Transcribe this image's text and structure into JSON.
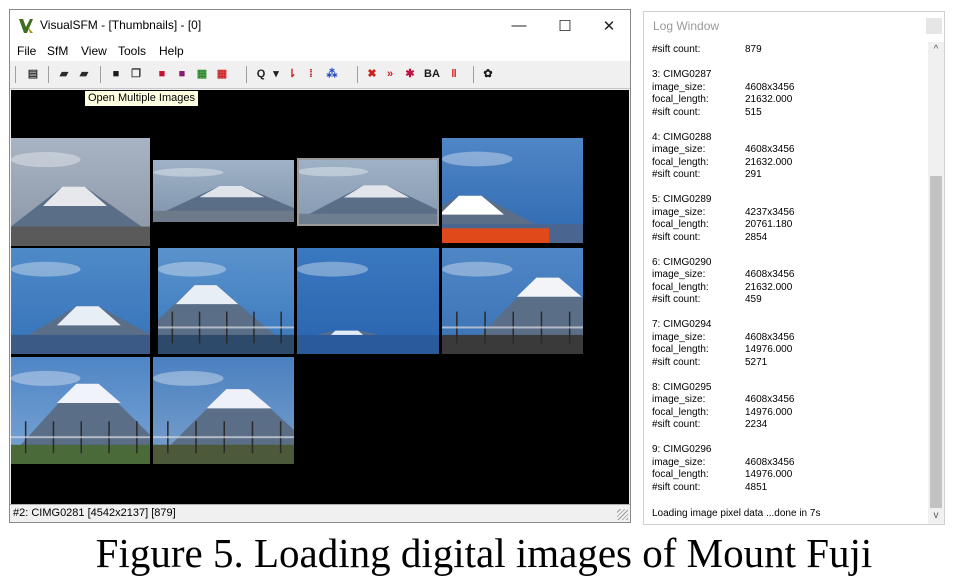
{
  "window": {
    "title": "VisualSFM - [Thumbnails] - [0]",
    "minimize_label": "—",
    "maximize_label": "☐",
    "close_label": "✕"
  },
  "menu": [
    "File",
    "SfM",
    "View",
    "Tools",
    "Help"
  ],
  "toolbar": {
    "buttons": [
      {
        "name": "log-icon",
        "glyph": "▤",
        "color": "#333333"
      },
      {
        "name": "open-folder-icon",
        "glyph": "▰",
        "color": "#2b2b2b"
      },
      {
        "name": "open-multiple-images-icon",
        "glyph": "▰",
        "color": "#2b2b2b"
      },
      {
        "name": "save-icon",
        "glyph": "■",
        "color": "#1a1a1a"
      },
      {
        "name": "copy-icon",
        "glyph": "❐",
        "color": "#333333"
      },
      {
        "name": "nvm-red-icon",
        "glyph": "■",
        "color": "#c4122f"
      },
      {
        "name": "nvm-purple-icon",
        "glyph": "■",
        "color": "#8a1a6b"
      },
      {
        "name": "grid-green-icon",
        "glyph": "▦",
        "color": "#2e8b2e"
      },
      {
        "name": "grid-color-icon",
        "glyph": "▦",
        "color": "#d0272a"
      },
      {
        "name": "zoom-icon",
        "glyph": "Q",
        "color": "#222222"
      },
      {
        "name": "dropdown-icon",
        "glyph": "▾",
        "color": "#222222"
      },
      {
        "name": "match-icon",
        "glyph": "⇂",
        "color": "#cc2020"
      },
      {
        "name": "sift-icon",
        "glyph": "⁞",
        "color": "#b01020"
      },
      {
        "name": "feature-icon",
        "glyph": "⁂",
        "color": "#2044c0"
      },
      {
        "name": "compute-icon",
        "glyph": "✖",
        "color": "#cc2020"
      },
      {
        "name": "forward-icon",
        "glyph": "»",
        "color": "#cc2020"
      },
      {
        "name": "sparse-icon",
        "glyph": "✱",
        "color": "#c01040"
      },
      {
        "name": "bundle-adjust-icon",
        "glyph": "BA",
        "color": "#1a1a1a"
      },
      {
        "name": "pause-icon",
        "glyph": "‖",
        "color": "#d01010"
      },
      {
        "name": "gear-icon",
        "glyph": "✿",
        "color": "#1a1a1a"
      }
    ],
    "tooltip": "Open Multiple Images"
  },
  "status": "#2: CIMG0281 [4542x2137] [879]",
  "log": {
    "title": "Log Window",
    "first_line": {
      "key": "#sift count:",
      "value": "879"
    },
    "entries": [
      {
        "header": "3: CIMG0287",
        "image_size": "4608x3456",
        "focal_length": "21632.000",
        "sift_count": "515"
      },
      {
        "header": "4: CIMG0288",
        "image_size": "4608x3456",
        "focal_length": "21632.000",
        "sift_count": "291"
      },
      {
        "header": "5: CIMG0289",
        "image_size": "4237x3456",
        "focal_length": "20761.180",
        "sift_count": "2854"
      },
      {
        "header": "6: CIMG0290",
        "image_size": "4608x3456",
        "focal_length": "21632.000",
        "sift_count": "459"
      },
      {
        "header": "7: CIMG0294",
        "image_size": "4608x3456",
        "focal_length": "14976.000",
        "sift_count": "5271"
      },
      {
        "header": "8: CIMG0295",
        "image_size": "4608x3456",
        "focal_length": "14976.000",
        "sift_count": "2234"
      },
      {
        "header": "9: CIMG0296",
        "image_size": "4608x3456",
        "focal_length": "14976.000",
        "sift_count": "4851"
      }
    ],
    "labels": {
      "image_size": "image_size:",
      "focal_length": "focal_length:",
      "sift_count": "#sift count:"
    },
    "footer": "Loading image pixel data ...done in 7s",
    "scroll_up": "^",
    "scroll_down": "v"
  },
  "caption": "Figure 5. Loading digital images of Mount Fuji",
  "colors": {
    "canvas": "#000000",
    "tooltip_bg": "#ffffe1",
    "window_bg": "#f0f0f0"
  }
}
